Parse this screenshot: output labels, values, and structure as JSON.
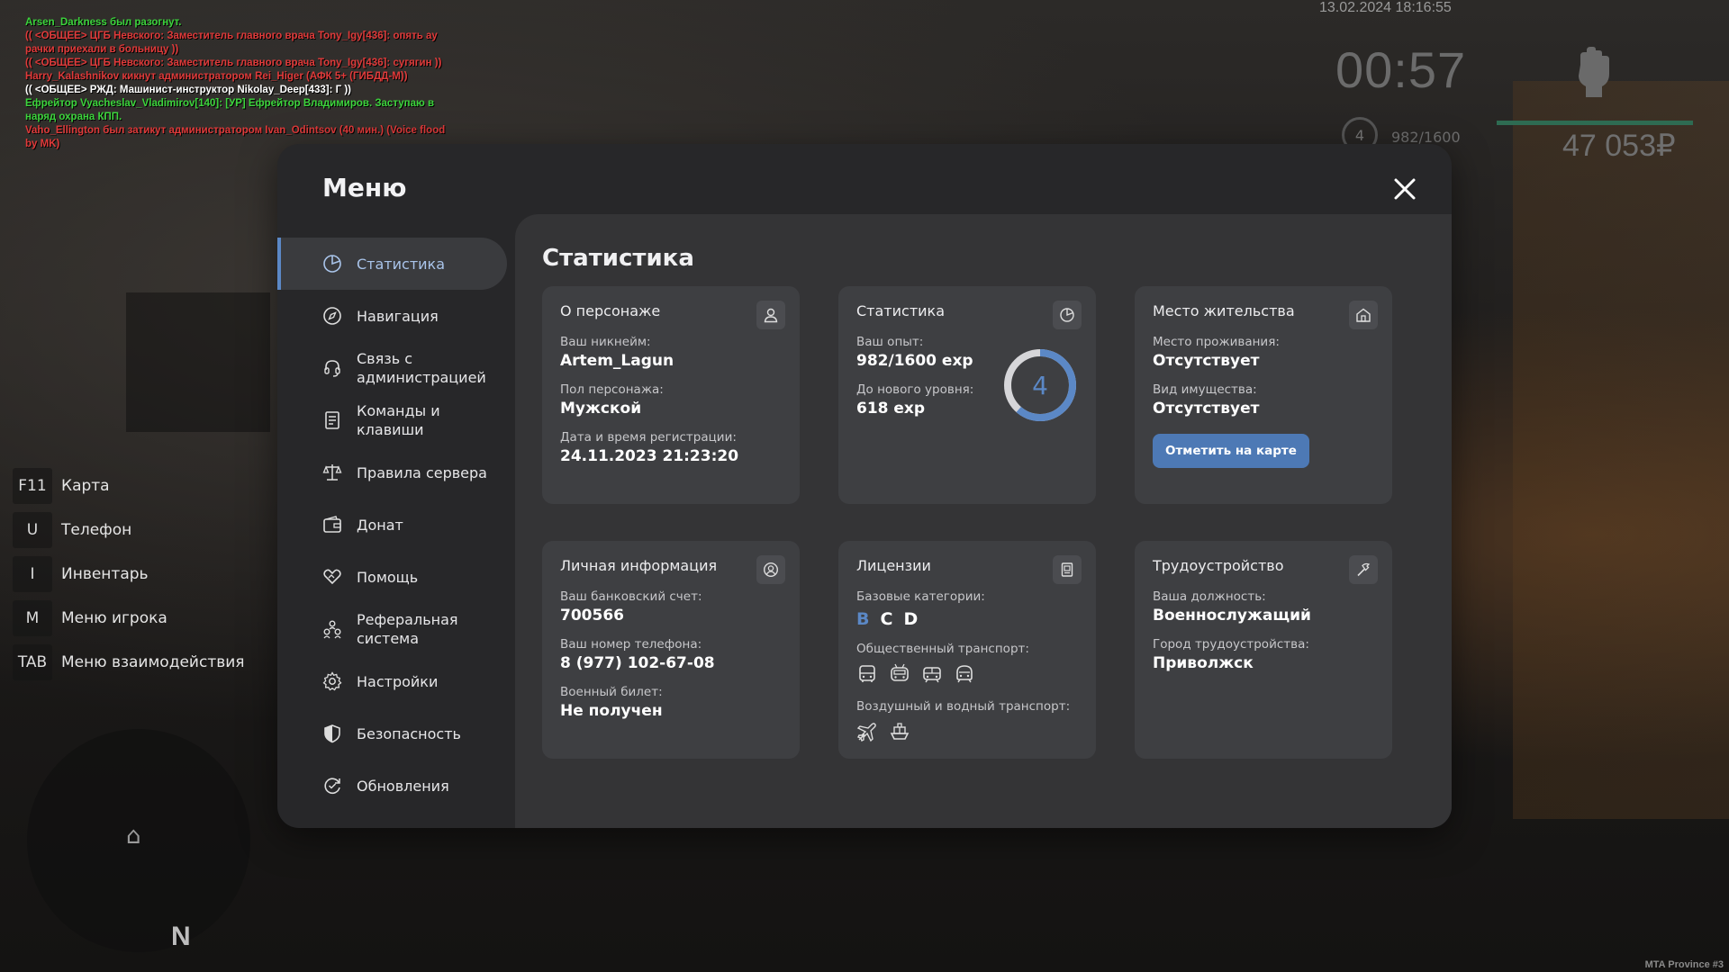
{
  "chat": [
    {
      "text": "Arsen_Darkness был разогнут.",
      "color": "#3cd43c"
    },
    {
      "text": "(( <ОБЩЕЕ> ЦГБ Невского: Заместитель главного врача Tony_Igy[436]: опять ау рачки приехали в больницу ))",
      "color": "#e03a3a"
    },
    {
      "text": "(( <ОБЩЕЕ> ЦГБ Невского: Заместитель главного врача Tony_Igy[436]: сугягин ))",
      "color": "#e03a3a"
    },
    {
      "text": "Harry_Kalashnikov кикнут администратором Rei_Higer (АФК 5+ (ГИБДД-М))",
      "color": "#e03a3a"
    },
    {
      "text": "(( <ОБЩЕЕ> РЖД: Машинист-инструктор Nikolay_Deep[433]: Г ))",
      "color": "#ffffff"
    },
    {
      "text": "Ефрейтор Vyacheslav_Vladimirov[140]: [УР] Ефрейтор Владимиров. Заступаю в наряд охрана КПП.",
      "color": "#3cd43c"
    },
    {
      "text": "Vaho_Ellington был затикут администратором Ivan_Odintsov (40 мин.) (Voice flood by MK)",
      "color": "#e03a3a"
    }
  ],
  "hud": {
    "date": "13.02.2024 18:16:55",
    "time": "00:57",
    "level": "4",
    "exp": "982/1600",
    "money": "47 053₽",
    "colors": {
      "health_bar": "#2e6b52"
    }
  },
  "keys": [
    {
      "key": "F11",
      "label": "Карта"
    },
    {
      "key": "U",
      "label": "Телефон"
    },
    {
      "key": "I",
      "label": "Инвентарь"
    },
    {
      "key": "M",
      "label": "Меню игрока"
    },
    {
      "key": "TAB",
      "label": "Меню взаимодействия"
    }
  ],
  "minimap": {
    "north": "N"
  },
  "watermark": "MTA Province #3",
  "menu": {
    "title": "Меню",
    "nav": [
      {
        "label": "Статистика",
        "icon": "pie-chart-icon",
        "active": true
      },
      {
        "label": "Навигация",
        "icon": "compass-icon"
      },
      {
        "label": "Связь с администрацией",
        "icon": "headset-icon"
      },
      {
        "label": "Команды и клавиши",
        "icon": "document-list-icon"
      },
      {
        "label": "Правила сервера",
        "icon": "scales-icon"
      },
      {
        "label": "Донат",
        "icon": "wallet-icon"
      },
      {
        "label": "Помощь",
        "icon": "handshake-heart-icon"
      },
      {
        "label": "Реферальная система",
        "icon": "people-icon"
      },
      {
        "label": "Настройки",
        "icon": "gear-icon"
      },
      {
        "label": "Безопасность",
        "icon": "shield-icon"
      },
      {
        "label": "Обновления",
        "icon": "refresh-check-icon"
      }
    ]
  },
  "stats": {
    "title": "Статистика",
    "character": {
      "title": "О персонаже",
      "nickname_label": "Ваш никнейм:",
      "nickname": "Artem_Lagun",
      "gender_label": "Пол персонажа:",
      "gender": "Мужской",
      "reg_label": "Дата и время регистрации:",
      "reg": "24.11.2023 21:23:20"
    },
    "experience": {
      "title": "Статистика",
      "exp_label": "Ваш опыт:",
      "exp": "982/1600 exp",
      "next_label": "До нового уровня:",
      "next": "618 exp",
      "level": "4",
      "progress": 0.614,
      "colors": {
        "ring": "#5b88c6",
        "track": "#d6d6d9"
      }
    },
    "residence": {
      "title": "Место жительства",
      "place_label": "Место проживания:",
      "place": "Отсутствует",
      "property_label": "Вид имущества:",
      "property": "Отсутствует",
      "button": "Отметить на карте"
    },
    "personal": {
      "title": "Личная информация",
      "bank_label": "Ваш банковский счет:",
      "bank": "700566",
      "phone_label": "Ваш номер телефона:",
      "phone": "8 (977) 102-67-08",
      "military_label": "Военный билет:",
      "military": "Не получен"
    },
    "licenses": {
      "title": "Лицензии",
      "base_label": "Базовые категории:",
      "categories": [
        "B",
        "C",
        "D"
      ],
      "public_label": "Общественный транспорт:",
      "public_icons": [
        "bus-icon",
        "trolleybus-icon",
        "tram-icon",
        "metro-icon"
      ],
      "air_label": "Воздушный и водный транспорт:",
      "air_icons": [
        "airplane-icon",
        "ship-icon"
      ]
    },
    "job": {
      "title": "Трудоустройство",
      "position_label": "Ваша должность:",
      "position": "Военнослужащий",
      "city_label": "Город трудоустройства:",
      "city": "Приволжск"
    }
  }
}
